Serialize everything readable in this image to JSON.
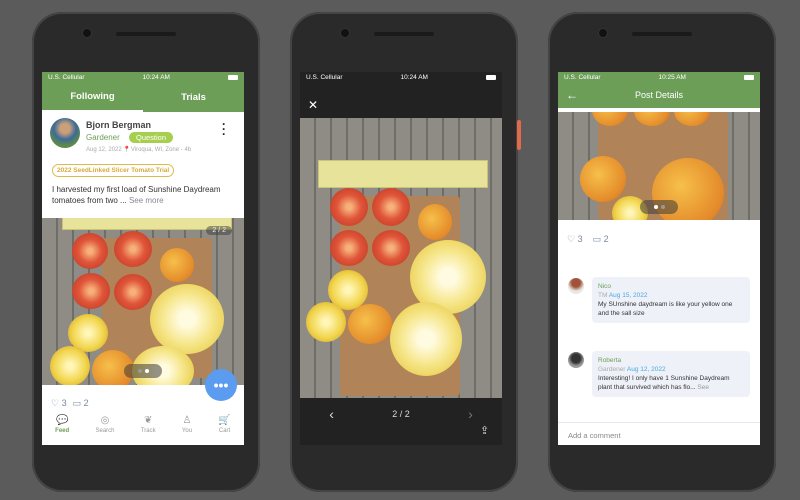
{
  "status": {
    "carrier": "U.S. Cellular",
    "time1": "10:24 AM",
    "time2": "10:24 AM",
    "time3": "10:25 AM"
  },
  "feed": {
    "tabs": [
      {
        "label": "Following",
        "active": true
      },
      {
        "label": "Trials",
        "active": false
      }
    ],
    "post": {
      "author": "Bjorn Bergman",
      "role": "Gardener",
      "badge": "Question",
      "date": "Aug 12, 2022",
      "location": "Viroqua, WI, Zone - 4b",
      "trial_tag": "2022 SeedLinked Slicer Tomato Trial",
      "text": "I harvested my first load of Sunshine Daydream tomatoes from two ...",
      "see_more": "See more",
      "image_counter": "2 / 2",
      "likes": "3",
      "comments": "2"
    },
    "bottom_nav": [
      {
        "label": "Feed",
        "icon": "chat-bubble-icon",
        "active": true
      },
      {
        "label": "Search",
        "icon": "compass-icon"
      },
      {
        "label": "Track",
        "icon": "sprout-icon"
      },
      {
        "label": "You",
        "icon": "person-icon"
      },
      {
        "label": "Cart",
        "icon": "cart-icon"
      }
    ]
  },
  "viewer": {
    "counter": "2 / 2"
  },
  "details": {
    "title": "Post Details",
    "likes": "3",
    "comments": "2",
    "comment_list": [
      {
        "name": "Nico",
        "role": "TM",
        "date": "Aug 15, 2022",
        "text": "My SUnshine daydream is like your yellow one and the sall size"
      },
      {
        "name": "Roberta",
        "role": "Gardener",
        "date": "Aug 12, 2022",
        "text": "Interesting! I only have 1 Sunshine Daydream plant that survived which has flo...",
        "see_more": "See"
      }
    ],
    "add_comment_placeholder": "Add a comment"
  },
  "colors": {
    "brand_green": "#6c9e57",
    "badge_green": "#a6cf4f",
    "tag_gold": "#e0b84a",
    "fab_blue": "#5b9bf0",
    "date_blue": "#4aa8e0"
  }
}
